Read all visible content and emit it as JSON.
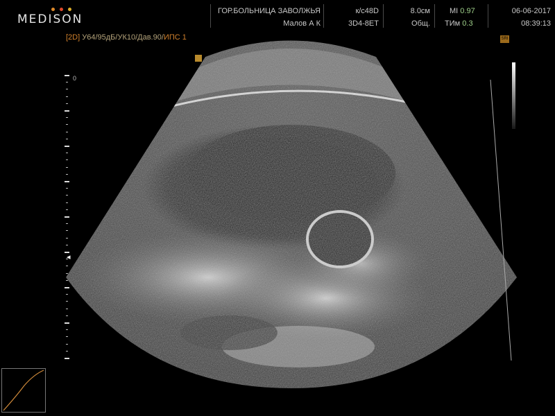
{
  "header": {
    "brand": "MEDISON",
    "brand_dot_colors": [
      "#e08a2a",
      "#e0492a",
      "#e0b02a"
    ],
    "hospital": "ГОР.БОЛЬНИЦА ЗАВОЛЖЬЯ",
    "operator": "Малов А К",
    "preset": "к/с48D",
    "probe": "3D4-8ET",
    "depth": "8.0см",
    "exam": "Общ.",
    "mi_label": "MI",
    "mi_value": "0.97",
    "tim_label": "ТИм",
    "tim_value": "0.3",
    "date": "06-06-2017",
    "time": "08:39:13"
  },
  "params": {
    "mode": "[2D]",
    "settings": " У64/95дБ/УК10/Дав.90/",
    "ips": "ИПС 1"
  },
  "depth_scale": {
    "zero_label": "0"
  },
  "colors": {
    "accent_orange": "#d0802c",
    "value_green": "#9fd08a",
    "marker": "#b88a2c"
  },
  "icons": {
    "focus": "focus-marker-icon",
    "sri": "sri-badge-icon",
    "probe": "probe-orientation-icon"
  }
}
